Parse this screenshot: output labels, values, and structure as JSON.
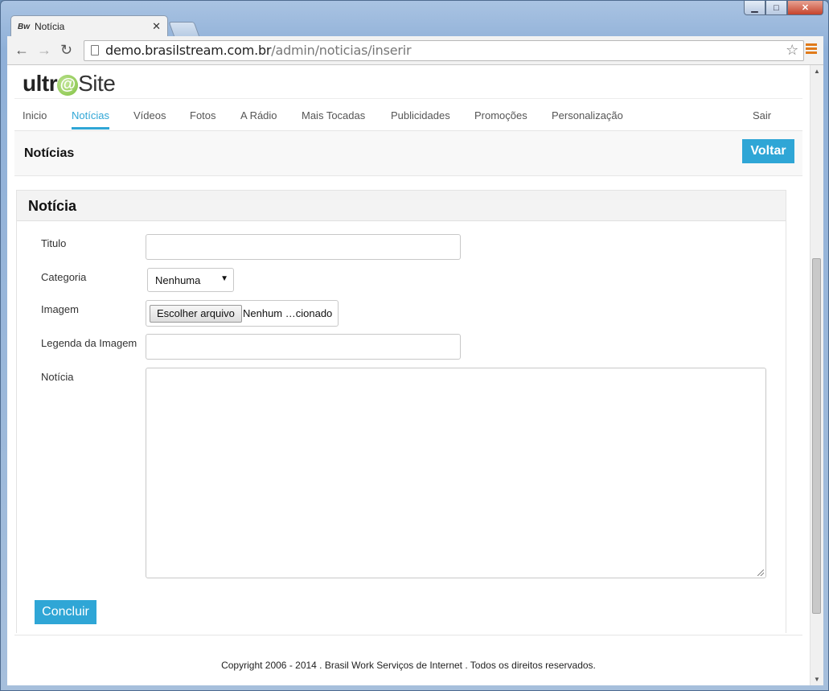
{
  "browser": {
    "tab_title": "Notícia",
    "tab_favicon": "Bw",
    "url_host": "demo.brasilstream.com.br",
    "url_path": "/admin/noticias/inserir"
  },
  "logo": {
    "part1": "ultr",
    "at": "@",
    "part2": "Site"
  },
  "nav": {
    "items": [
      "Inicio",
      "Notícias",
      "Vídeos",
      "Fotos",
      "A Rádio",
      "Mais Tocadas",
      "Publicidades",
      "Promoções",
      "Personalização"
    ],
    "active": "Notícias",
    "logout": "Sair"
  },
  "header": {
    "title": "Notícias",
    "back_button": "Voltar"
  },
  "form": {
    "panel_title": "Notícia",
    "titulo_label": "Titulo",
    "titulo_value": "",
    "categoria_label": "Categoria",
    "categoria_value": "Nenhuma",
    "imagem_label": "Imagem",
    "file_button": "Escolher arquivo",
    "file_status": "Nenhum …cionado",
    "legenda_label": "Legenda da Imagem",
    "legenda_value": "",
    "noticia_label": "Notícia",
    "noticia_value": "",
    "submit": "Concluir"
  },
  "footer": {
    "copyright": "Copyright 2006 - 2014 . Brasil Work Serviços de Internet . Todos os direitos reservados."
  },
  "colors": {
    "accent": "#2fa6d6",
    "logo_green": "#7cbf3a"
  }
}
